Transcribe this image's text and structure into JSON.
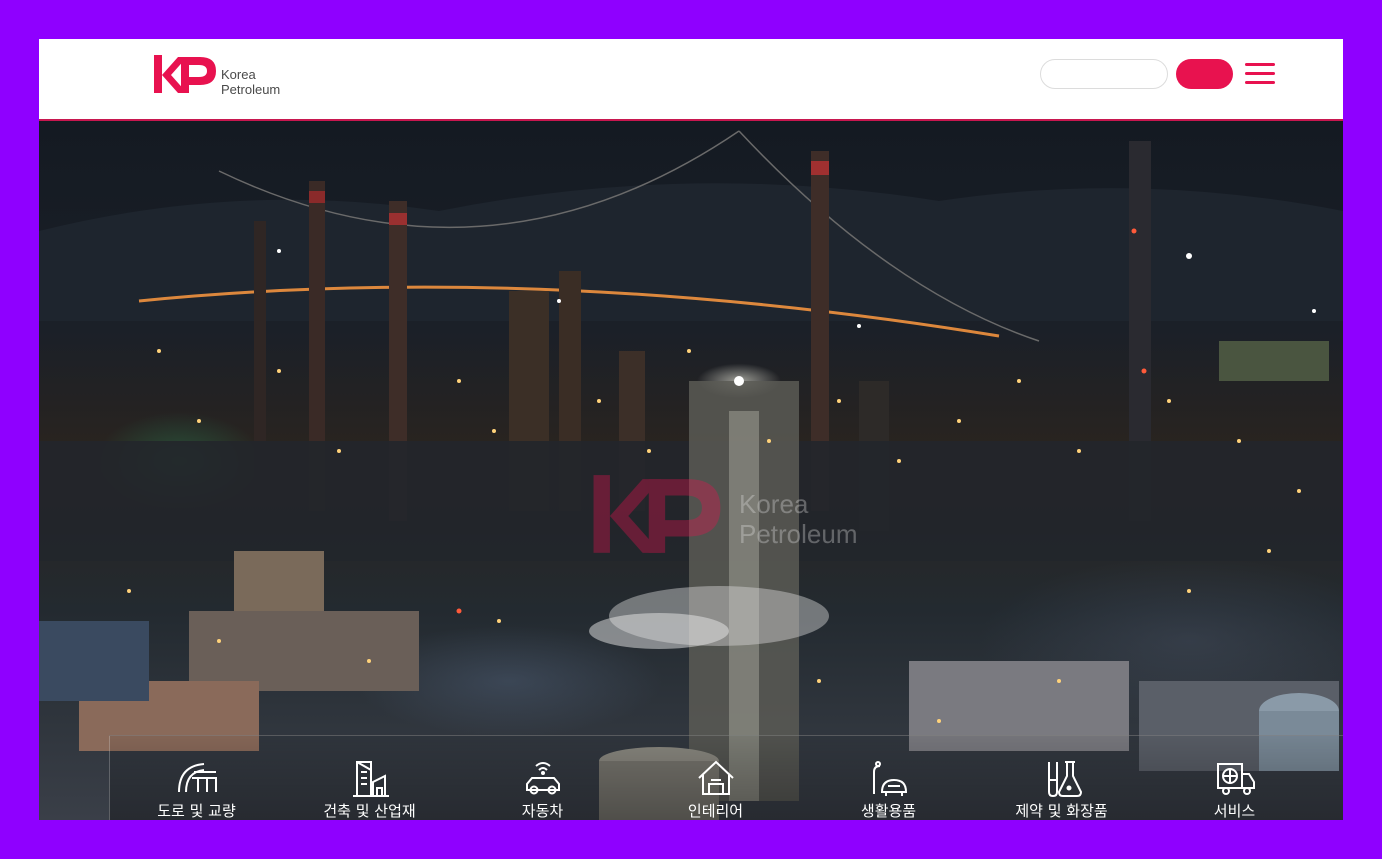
{
  "header": {
    "logo_line1": "Korea",
    "logo_line2": "Petroleum",
    "search_placeholder": "",
    "search_value": "",
    "search_button_label": "",
    "menu_icon": "hamburger-menu-icon"
  },
  "hero": {
    "watermark_line1": "Korea",
    "watermark_line2": "Petroleum"
  },
  "categories": [
    {
      "label": "도로 및 교량",
      "icon": "road-bridge-icon"
    },
    {
      "label": "건축 및 산업재",
      "icon": "building-industrial-icon"
    },
    {
      "label": "자동차",
      "icon": "car-icon"
    },
    {
      "label": "인테리어",
      "icon": "house-interior-icon"
    },
    {
      "label": "생활용품",
      "icon": "household-goods-icon"
    },
    {
      "label": "제약 및 화장품",
      "icon": "pharma-flask-icon"
    },
    {
      "label": "서비스",
      "icon": "service-truck-icon"
    }
  ],
  "colors": {
    "brand": "#e8124f",
    "background": "#8f00ff",
    "header_bg": "#ffffff"
  }
}
